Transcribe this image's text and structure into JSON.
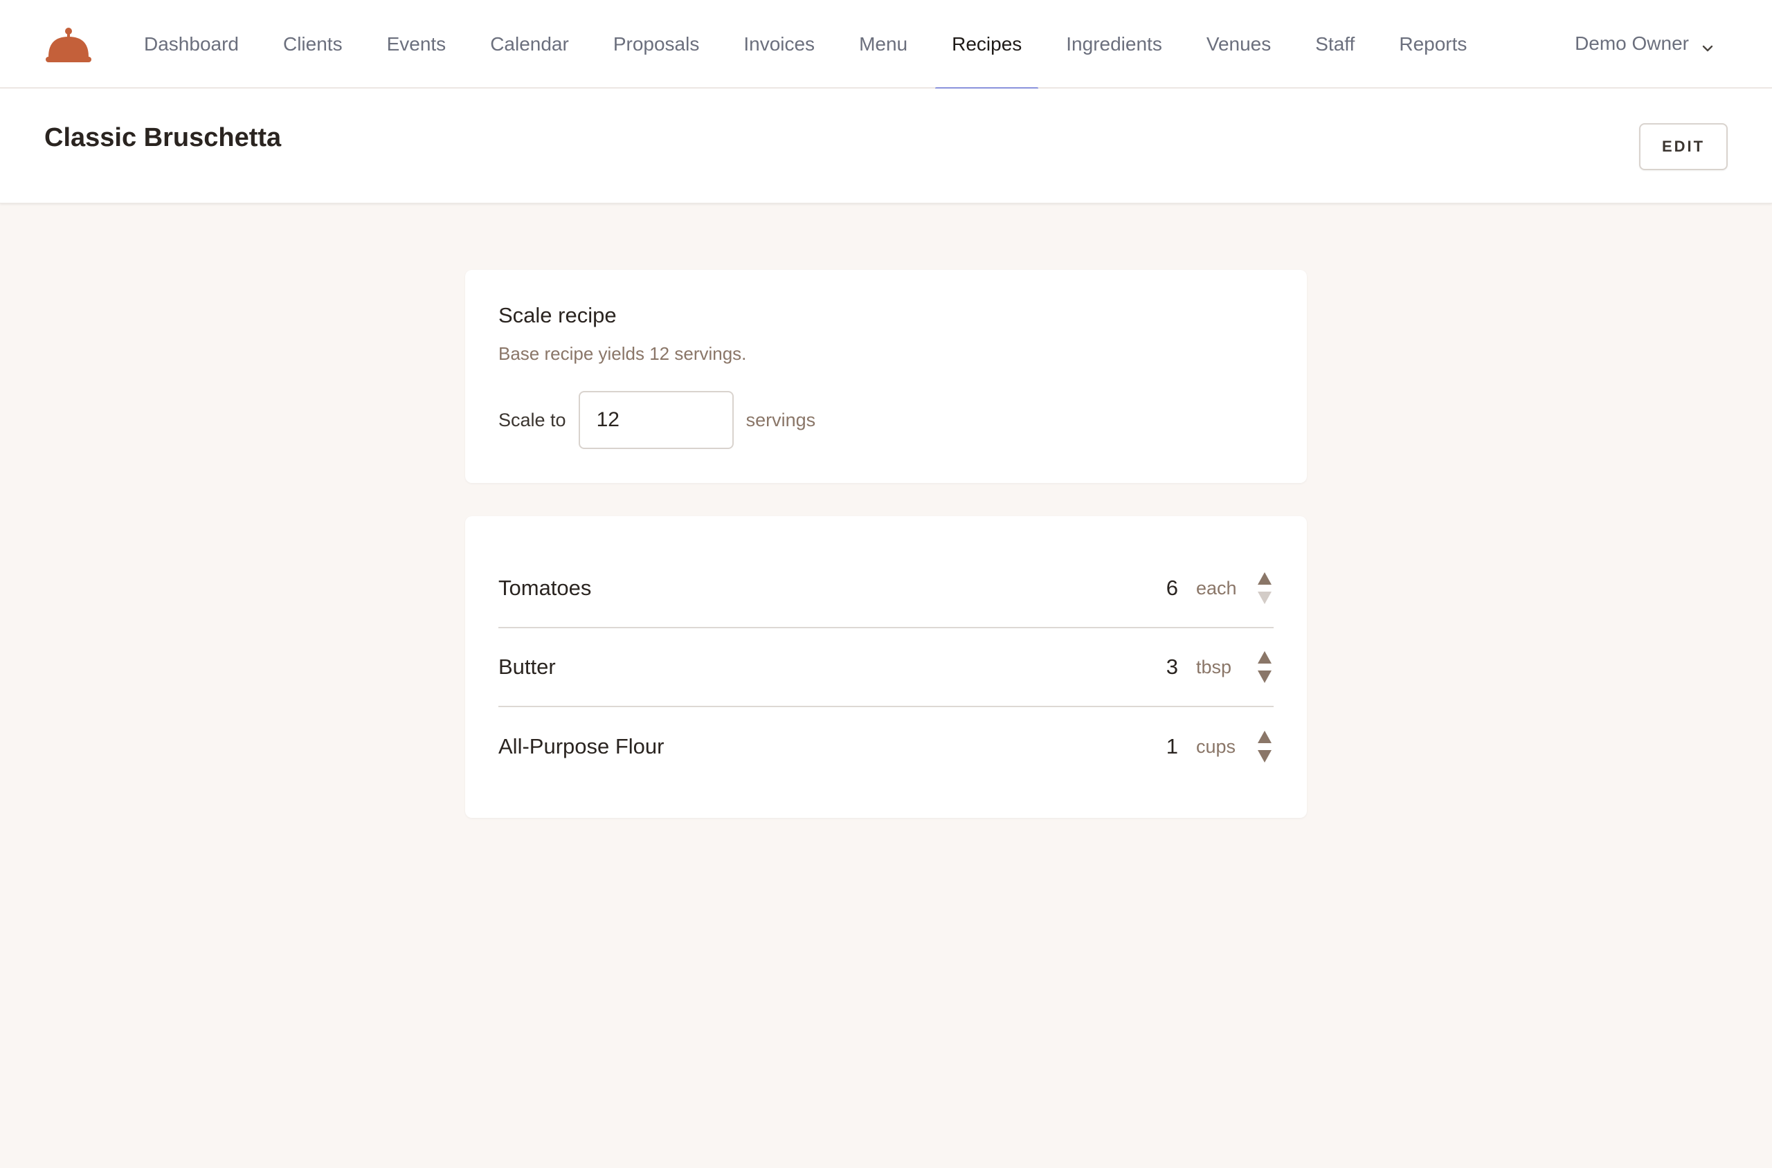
{
  "nav": {
    "items": [
      {
        "id": "dashboard",
        "label": "Dashboard",
        "active": false
      },
      {
        "id": "clients",
        "label": "Clients",
        "active": false
      },
      {
        "id": "events",
        "label": "Events",
        "active": false
      },
      {
        "id": "calendar",
        "label": "Calendar",
        "active": false
      },
      {
        "id": "proposals",
        "label": "Proposals",
        "active": false
      },
      {
        "id": "invoices",
        "label": "Invoices",
        "active": false
      },
      {
        "id": "menu",
        "label": "Menu",
        "active": false
      },
      {
        "id": "recipes",
        "label": "Recipes",
        "active": true
      },
      {
        "id": "ingredients",
        "label": "Ingredients",
        "active": false
      },
      {
        "id": "venues",
        "label": "Venues",
        "active": false
      },
      {
        "id": "staff",
        "label": "Staff",
        "active": false
      },
      {
        "id": "reports",
        "label": "Reports",
        "active": false
      }
    ],
    "user_name": "Demo Owner"
  },
  "header": {
    "title": "Classic Bruschetta",
    "edit_label": "EDIT"
  },
  "scale": {
    "title": "Scale recipe",
    "subtitle": "Base recipe yields 12 servings.",
    "scale_to_label": "Scale to",
    "value": "12",
    "servings_label": "servings"
  },
  "ingredients": [
    {
      "name": "Tomatoes",
      "qty": "6",
      "unit": "each"
    },
    {
      "name": "Butter",
      "qty": "3",
      "unit": "tbsp"
    },
    {
      "name": "All-Purpose Flour",
      "qty": "1",
      "unit": "cups"
    }
  ],
  "colors": {
    "brand": "#c4603a",
    "active_underline": "#8b93dc",
    "background": "#faf6f3",
    "muted_text": "#8a7668",
    "stepper": "#8a7668",
    "stepper_disabled": "#d3ccc7"
  }
}
